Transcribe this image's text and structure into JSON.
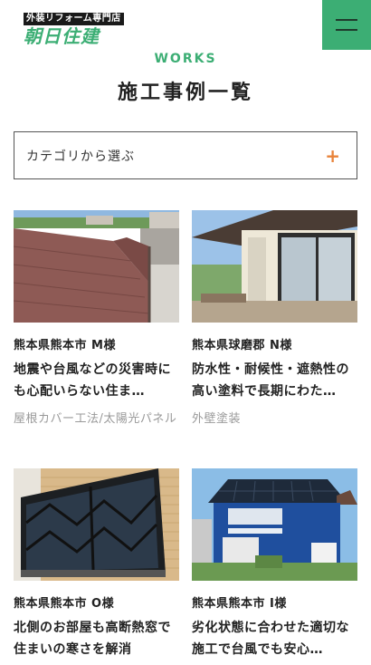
{
  "header": {
    "logo_sub": "外装リフォーム専門店",
    "logo_main": "朝日住建",
    "menu_icon": "hamburger-menu-icon"
  },
  "section": {
    "en": "WORKS",
    "title": "施工事例一覧"
  },
  "category": {
    "label": "カテゴリから選ぶ",
    "icon": "plus-icon"
  },
  "cards": [
    {
      "location": "熊本県熊本市 M様",
      "title": "地震や台風などの災害時にも心配いらない住ま…",
      "tags": "屋根カバー工法/太陽光パネル"
    },
    {
      "location": "熊本県球磨郡 N様",
      "title": "防水性・耐候性・遮熱性の高い塗料で長期にわた…",
      "tags": "外壁塗装"
    },
    {
      "location": "熊本県熊本市 O様",
      "title": "北側のお部屋も高断熱窓で住まいの寒さを解消",
      "tags": ""
    },
    {
      "location": "熊本県熊本市 I様",
      "title": "劣化状態に合わせた適切な施工で台風でも安心…",
      "tags": ""
    }
  ],
  "colors": {
    "brand_green": "#3cae74",
    "accent_orange": "#e8833a"
  }
}
